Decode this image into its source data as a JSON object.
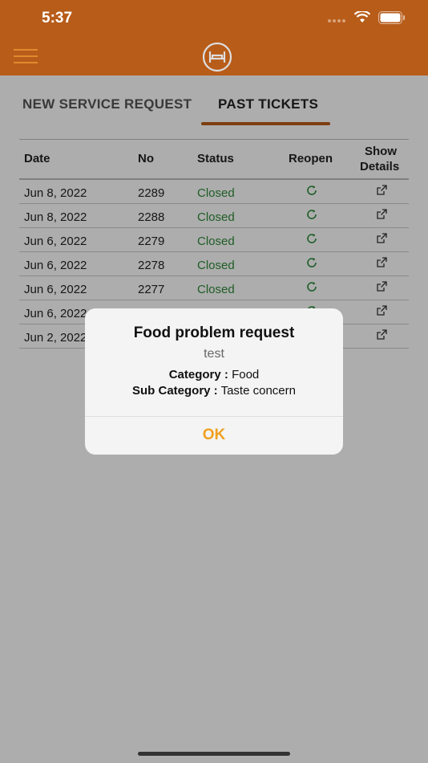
{
  "status_bar": {
    "time": "5:37"
  },
  "tabs": [
    {
      "label": "NEW SERVICE REQUEST"
    },
    {
      "label": "PAST TICKETS"
    }
  ],
  "table": {
    "headers": {
      "date": "Date",
      "no": "No",
      "status": "Status",
      "reopen": "Reopen",
      "show_line1": "Show",
      "show_line2": "Details"
    },
    "rows": [
      {
        "date": "Jun 8, 2022",
        "no": "2289",
        "status": "Closed"
      },
      {
        "date": "Jun 8, 2022",
        "no": "2288",
        "status": "Closed"
      },
      {
        "date": "Jun 6, 2022",
        "no": "2279",
        "status": "Closed"
      },
      {
        "date": "Jun 6, 2022",
        "no": "2278",
        "status": "Closed"
      },
      {
        "date": "Jun 6, 2022",
        "no": "2277",
        "status": "Closed"
      },
      {
        "date": "Jun 6, 2022",
        "no": "",
        "status": ""
      },
      {
        "date": "Jun 2, 2022",
        "no": "",
        "status": ""
      }
    ]
  },
  "dialog": {
    "title": "Food problem request",
    "message": "test",
    "category_label": "Category :",
    "category_value": "Food",
    "subcategory_label": "Sub Category :",
    "subcategory_value": "Taste concern",
    "ok_label": "OK"
  },
  "colors": {
    "brand": "#b85c1a",
    "status_closed": "#2e8a3a",
    "ok": "#f0a020"
  },
  "icons": {
    "reopen": "refresh-icon",
    "show": "external-link-icon",
    "menu": "hamburger-menu-icon",
    "logo": "bed-icon"
  }
}
